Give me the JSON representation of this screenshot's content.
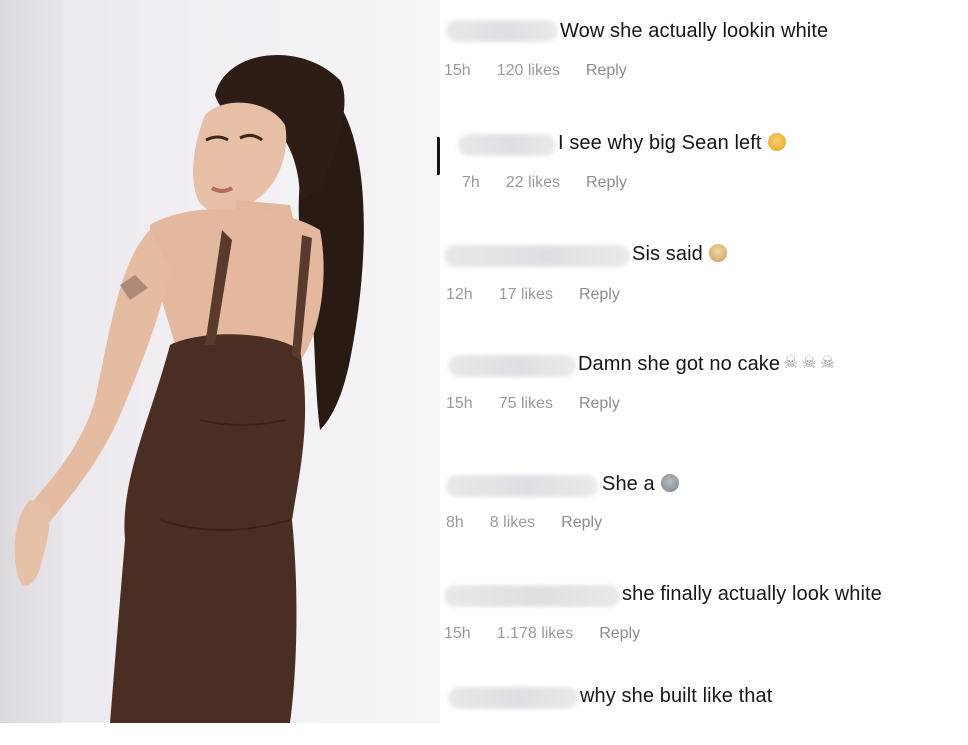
{
  "comments": [
    {
      "text": "Wow she actually lookin white",
      "time": "15h",
      "likes": "120 likes",
      "reply": "Reply",
      "emoji": []
    },
    {
      "text": "I see why big Sean left",
      "time": "7h",
      "likes": "22 likes",
      "reply": "Reply",
      "emoji": [
        "laughing-crying-emoji"
      ]
    },
    {
      "text": "Sis said",
      "time": "12h",
      "likes": "17 likes",
      "reply": "Reply",
      "emoji": [
        "cake-emoji"
      ]
    },
    {
      "text": "Damn she got no cake",
      "time": "15h",
      "likes": "75 likes",
      "reply": "Reply",
      "emoji": [
        "skull-crossbones-emoji",
        "skull-crossbones-emoji",
        "skull-crossbones-emoji"
      ]
    },
    {
      "text": "She a",
      "time": "8h",
      "likes": "8 likes",
      "reply": "Reply",
      "emoji": [
        "alien-emoji"
      ]
    },
    {
      "text": "she finally actually look white",
      "time": "15h",
      "likes": "1.178 likes",
      "reply": "Reply",
      "emoji": []
    },
    {
      "text": "why she built like that",
      "time": "",
      "likes": "",
      "reply": "",
      "emoji": []
    }
  ],
  "colors": {
    "dress": "#4a2e24",
    "hair": "#2a1a14",
    "skin": "#e3b79d",
    "meta_gray": "#9a9a9a"
  }
}
